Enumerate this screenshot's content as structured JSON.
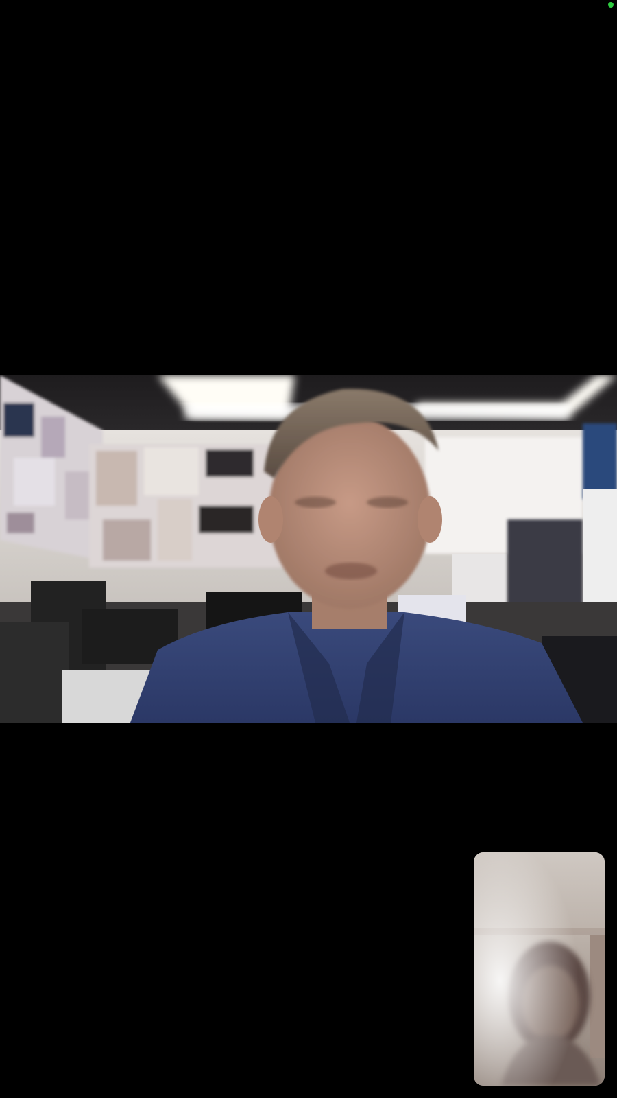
{
  "call": {
    "camera_indicator": "camera-in-use",
    "indicator_color": "#2ecc40",
    "remote_feed": "remote-participant-video",
    "self_feed": "self-view-video"
  }
}
